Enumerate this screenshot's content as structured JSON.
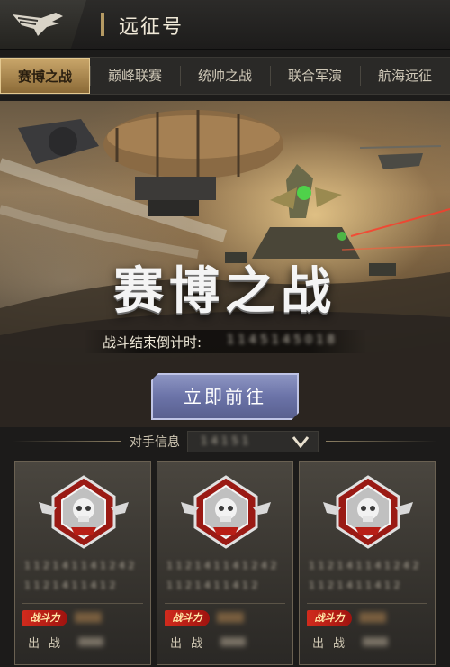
{
  "header": {
    "title": "远征号",
    "back_icon": "wing-logo-icon"
  },
  "tabs": [
    {
      "label": "赛博之战",
      "active": true
    },
    {
      "label": "巅峰联赛",
      "active": false
    },
    {
      "label": "统帅之战",
      "active": false
    },
    {
      "label": "联合军演",
      "active": false
    },
    {
      "label": "航海远征",
      "active": false
    }
  ],
  "banner": {
    "title": "赛博之战",
    "countdown_label": "战斗结束倒计时:",
    "countdown_value": "1 1 4 5 1 4 5 0 1 8"
  },
  "go_button": {
    "label": "立即前往"
  },
  "opponent": {
    "label": "对手信息",
    "selected": "1 4 1 5 1"
  },
  "cards": [
    {
      "line1": "1 1 2 1 4  1 1 4 1 2 4 2",
      "line2": "1 1 2 1 4  1 1 4 1 2",
      "power_label": "战斗力",
      "deploy_label": "出战"
    },
    {
      "line1": "1 1 2 1 4  1 1 4 1 2 4 2",
      "line2": "1 1 2 1 4  1 1 4 1 2",
      "power_label": "战斗力",
      "deploy_label": "出战"
    },
    {
      "line1": "1 1 2 1 4  1 1 4 1 2 4 2",
      "line2": "1 1 2 1 4  1 1 4 1 2",
      "power_label": "战斗力",
      "deploy_label": "出战"
    }
  ],
  "colors": {
    "accent_gold": "#c9a66a",
    "button_blue": "#6b73a8",
    "power_red": "#d12b1d"
  }
}
